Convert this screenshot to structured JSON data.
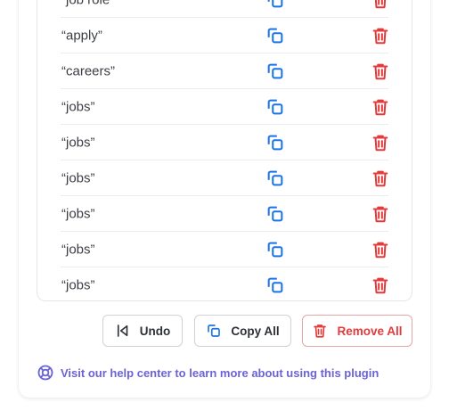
{
  "keywords": [
    {
      "label": "“job role”"
    },
    {
      "label": "“apply”"
    },
    {
      "label": "“careers”"
    },
    {
      "label": "“jobs”"
    },
    {
      "label": "“jobs”"
    },
    {
      "label": "“jobs”"
    },
    {
      "label": "“jobs”"
    },
    {
      "label": "“jobs”"
    },
    {
      "label": "“jobs”"
    }
  ],
  "actions": {
    "undo_label": "Undo",
    "copy_all_label": "Copy All",
    "remove_all_label": "Remove All"
  },
  "help": {
    "text": "Visit our help center to learn more about using this plugin"
  },
  "colors": {
    "copy_icon": "#1a73e8",
    "delete_icon": "#e33b3b",
    "help_link": "#6b63d6"
  },
  "icons": {
    "copy": "copy-icon",
    "delete": "trash-icon",
    "undo": "undo-icon",
    "help": "lifebuoy-icon"
  }
}
